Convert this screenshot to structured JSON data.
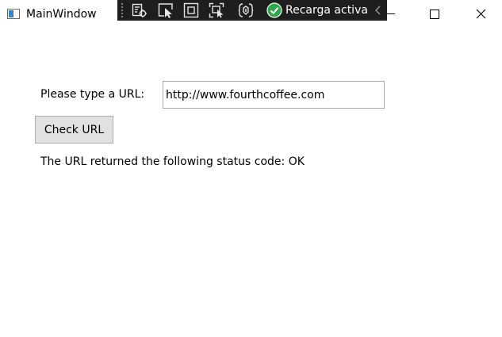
{
  "window": {
    "title": "MainWindow"
  },
  "devtools": {
    "hot_reload_label": "Recarga activa",
    "icons": [
      "live-visual-tree-icon",
      "select-element-icon",
      "display-layout-adorners-icon",
      "track-focus-icon",
      "binding-failures-icon",
      "hot-reload-ok-icon",
      "collapse-chevron-icon"
    ],
    "background": "#1e1e1e",
    "hot_reload_color": "#2ea84a"
  },
  "form": {
    "url_label": "Please type a URL:",
    "url_value": "http://www.fourthcoffee.com",
    "check_button_label": "Check URL",
    "status_text": "The URL returned the following status code:",
    "status_code": "OK"
  }
}
